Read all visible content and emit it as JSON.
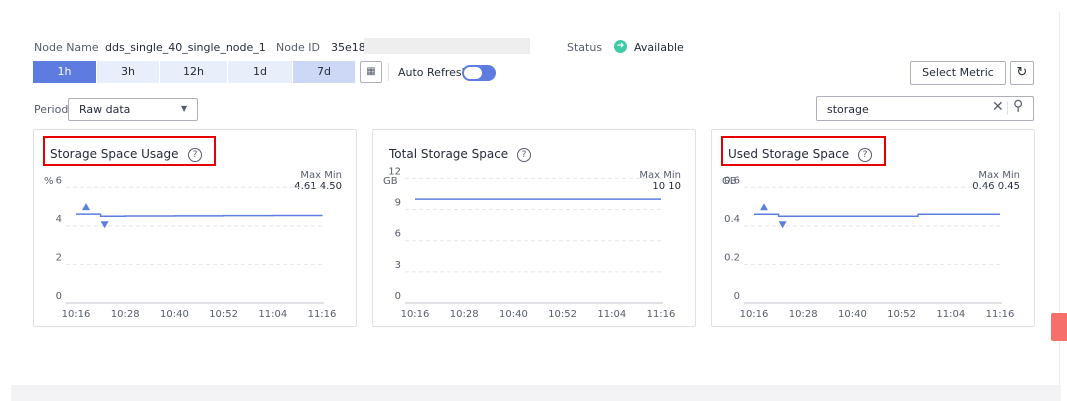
{
  "header": {
    "node_name_label": "Node Name",
    "node_name": "dds_single_40_single_node_1",
    "node_id_label": "Node ID",
    "node_id": "35e189a",
    "status_label": "Status",
    "status_value": "Available",
    "status_icon": "arrow-right-circle-icon"
  },
  "time_ranges": [
    "1h",
    "3h",
    "12h",
    "1d",
    "7d"
  ],
  "selected_time_range": "1h",
  "toolbar": {
    "auto_refresh_label": "Auto Refresh",
    "auto_refresh_on": true,
    "select_metric_label": "Select Metric",
    "refresh_icon": "refresh-icon"
  },
  "period": {
    "label": "Period",
    "value": "Raw data"
  },
  "search": {
    "value": "storage"
  },
  "colors": {
    "accent": "#5e7ce0",
    "highlight_border": "#e60000",
    "status": "#3dcca6",
    "line": "#5b7fe0"
  },
  "charts": [
    {
      "title": "Storage Space Usage",
      "unit": "%",
      "max_label": "Max",
      "min_label": "Min",
      "max_value": "4.61",
      "min_value": "4.50",
      "highlighted": true,
      "y_ticks": [
        "6",
        "4",
        "2",
        "0"
      ],
      "x_ticks": [
        "10:16",
        "10:28",
        "10:40",
        "10:52",
        "11:04",
        "11:16"
      ]
    },
    {
      "title": "Total Storage Space",
      "unit": "GB",
      "max_label": "Max",
      "min_label": "Min",
      "max_value": "10",
      "min_value": "10",
      "highlighted": false,
      "y_ticks": [
        "12",
        "9",
        "6",
        "3",
        "0"
      ],
      "x_ticks": [
        "10:16",
        "10:28",
        "10:40",
        "10:52",
        "11:04",
        "11:16"
      ]
    },
    {
      "title": "Used Storage Space",
      "unit": "GB",
      "max_label": "Max",
      "min_label": "Min",
      "max_value": "0.46",
      "min_value": "0.45",
      "highlighted": true,
      "y_ticks": [
        "0.6",
        "0.4",
        "0.2",
        "0"
      ],
      "x_ticks": [
        "10:16",
        "10:28",
        "10:40",
        "10:52",
        "11:04",
        "11:16"
      ]
    }
  ],
  "chart_data": [
    {
      "type": "line",
      "title": "Storage Space Usage",
      "ylabel": "%",
      "ylim": [
        0,
        7
      ],
      "x": [
        "10:16",
        "10:20",
        "10:22",
        "10:28",
        "10:40",
        "10:52",
        "11:04",
        "11:16"
      ],
      "series": [
        {
          "values": [
            4.61,
            4.61,
            4.5,
            4.51,
            4.52,
            4.53,
            4.54,
            4.55
          ]
        }
      ],
      "max_marker": "4.61",
      "min_marker": "4.50"
    },
    {
      "type": "line",
      "title": "Total Storage Space",
      "ylabel": "GB",
      "ylim": [
        0,
        13
      ],
      "x": [
        "10:16",
        "10:28",
        "10:40",
        "10:52",
        "11:04",
        "11:16"
      ],
      "series": [
        {
          "values": [
            10,
            10,
            10,
            10,
            10,
            10
          ]
        }
      ]
    },
    {
      "type": "line",
      "title": "Used Storage Space",
      "ylabel": "GB",
      "ylim": [
        0,
        0.7
      ],
      "x": [
        "10:16",
        "10:20",
        "10:22",
        "10:28",
        "10:40",
        "10:52",
        "10:56",
        "11:04",
        "11:16"
      ],
      "series": [
        {
          "values": [
            0.46,
            0.46,
            0.45,
            0.45,
            0.45,
            0.45,
            0.46,
            0.46,
            0.46
          ]
        }
      ],
      "max_marker": "0.46",
      "min_marker": "0.45"
    }
  ]
}
